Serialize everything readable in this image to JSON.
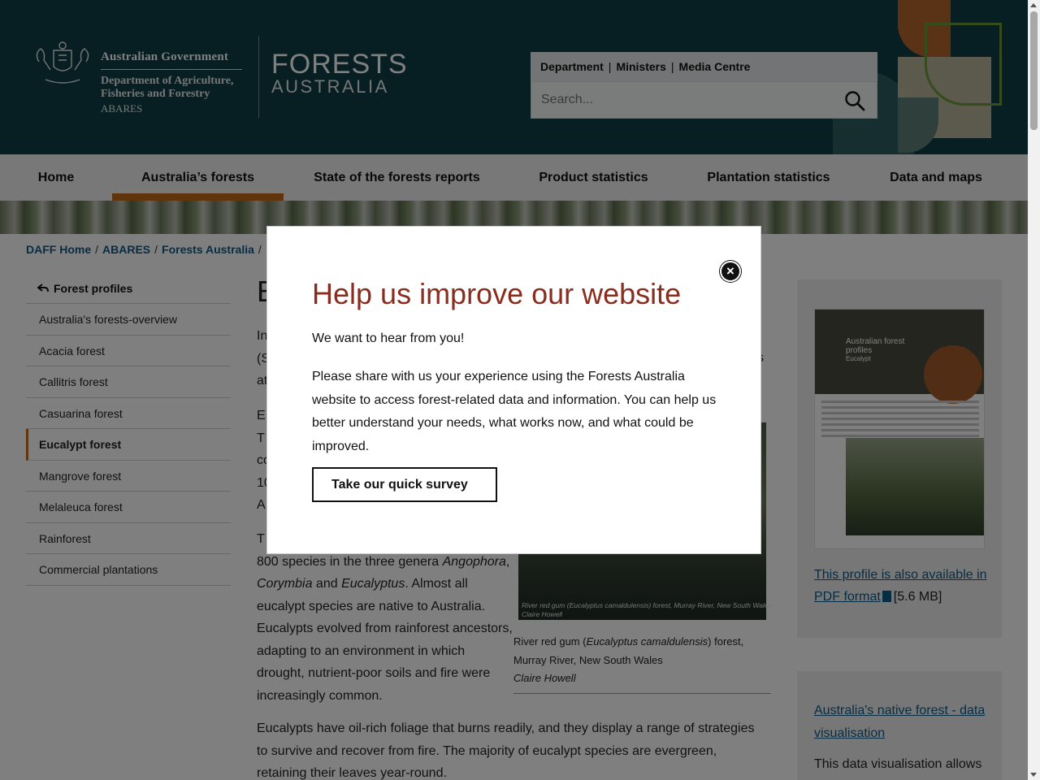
{
  "header": {
    "gov_title": "Australian Government",
    "gov_dept_line1": "Department of Agriculture,",
    "gov_dept_line2": "Fisheries and Forestry",
    "gov_abares": "ABARES",
    "site_line1": "FORESTS",
    "site_line2": "AUSTRALIA",
    "utility_links": [
      "Department",
      "Ministers",
      "Media Centre"
    ],
    "search_placeholder": "Search..."
  },
  "nav": {
    "items": [
      "Home",
      "Australia’s forests",
      "State of the forests reports",
      "Product statistics",
      "Plantation statistics",
      "Data and maps"
    ],
    "active": "Australia’s forests"
  },
  "breadcrumb": [
    "DAFF Home",
    "ABARES",
    "Forests Australia"
  ],
  "sidebar": {
    "heading": "Forest profiles",
    "items": [
      "Australia's forests-overview",
      "Acacia forest",
      "Callitris forest",
      "Casuarina forest",
      "Eucalypt forest",
      "Mangrove forest",
      "Melaleuca forest",
      "Rainforest",
      "Commercial plantations"
    ],
    "active": "Eucalypt forest"
  },
  "main": {
    "title_initial": "E",
    "p1_frag": [
      "In",
      "(S",
      "at"
    ],
    "p1_right": "s",
    "p2_frag": [
      "E",
      "T",
      "co",
      "10",
      "A"
    ],
    "p3_line0": "T",
    "p3_line1_pre": "800 species in the three genera ",
    "p3_line1_em": "Angophora",
    "p3_line1_post": ",",
    "p3_line2_em": "Corymbia",
    "p3_line2_mid": " and ",
    "p3_line2_em2": "Eucalyptus",
    "p3_line2_post": ". Almost all",
    "p3_lines": [
      "eucalypt species are native to Australia.",
      "Eucalypts evolved from rainforest ancestors,",
      "adapting to an environment in which",
      "drought, nutrient-poor soils and fire were",
      "increasingly common."
    ],
    "p4": "Eucalypts have oil-rich foliage that burns readily, and they display a range of strategies to survive and recover from fire. The majority of eucalypt species are evergreen, retaining their leaves year-round.",
    "figure_overlay_line1": "River red gum (Eucalyptus camaldulensis) forest, Murray River, New South Wales",
    "figure_overlay_line2": "Claire Howell",
    "caption_pre": "River red gum (",
    "caption_em": "Eucalyptus camaldulensis",
    "caption_post": ") forest,",
    "caption_line2": "Murray River, New South Wales",
    "caption_credit": "Claire Howell"
  },
  "rail": {
    "thumb_title1": "Australian forest",
    "thumb_title2": "profiles",
    "thumb_title3": "Eucalypt",
    "pdf_link": "This profile is also available in PDF format",
    "pdf_size": "[5.6 MB]",
    "viz_link": "Australia's native forest - data visualisation",
    "viz_desc": "This data visualisation allows"
  },
  "modal": {
    "title": "Help us improve our website",
    "p1": "We want to hear from you!",
    "p2": "Please share with us your experience using the Forests Australia website to access forest-related data and information. You can help us better understand your needs, what works now, and what could be improved.",
    "button": "Take our quick survey",
    "close_symbol": "×"
  },
  "colors": {
    "header_bg": "#0f3f47",
    "accent": "#c26a16",
    "link": "#0c5a87",
    "modal_title": "#8a2d1e"
  }
}
